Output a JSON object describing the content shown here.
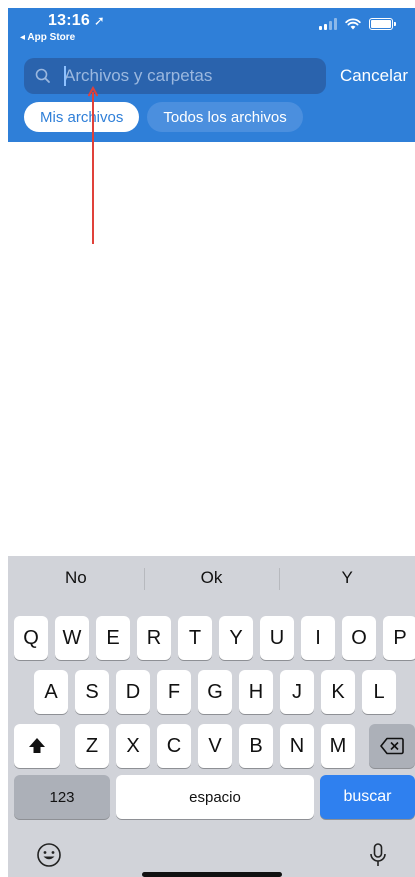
{
  "status": {
    "time": "13:16",
    "back_app": "◂ App Store"
  },
  "search": {
    "placeholder": "Archivos y carpetas",
    "value": "",
    "cancel_label": "Cancelar"
  },
  "filters": [
    {
      "label": "Mis archivos",
      "active": true
    },
    {
      "label": "Todos los archivos",
      "active": false
    }
  ],
  "keyboard": {
    "suggestions": [
      "No",
      "Ok",
      "Y"
    ],
    "row1": [
      "Q",
      "W",
      "E",
      "R",
      "T",
      "Y",
      "U",
      "I",
      "O",
      "P"
    ],
    "row2": [
      "A",
      "S",
      "D",
      "F",
      "G",
      "H",
      "J",
      "K",
      "L"
    ],
    "row3": [
      "Z",
      "X",
      "C",
      "V",
      "B",
      "N",
      "M"
    ],
    "numbers_label": "123",
    "space_label": "espacio",
    "action_label": "buscar",
    "icons": {
      "shift": "shift-icon",
      "delete": "backspace-icon",
      "emoji": "emoji-icon",
      "mic": "microphone-icon"
    }
  },
  "colors": {
    "header_bg": "#2f7fd8",
    "search_bg": "#2a63ad",
    "action_key": "#2f80ef",
    "annotation": "#e0413a"
  }
}
